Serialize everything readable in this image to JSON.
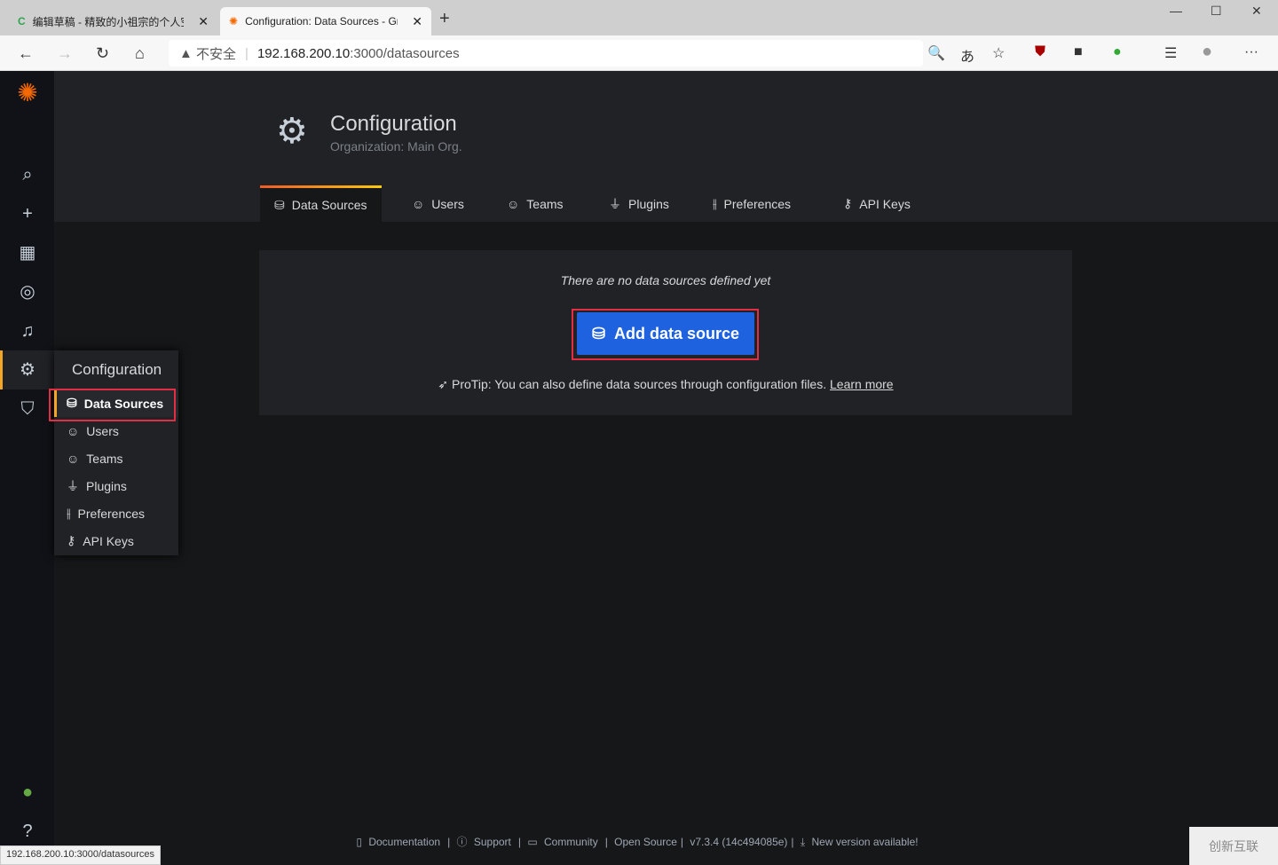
{
  "browser": {
    "tabs": [
      {
        "title": "编辑草稿 - 精致的小祖宗的个人空"
      },
      {
        "title": "Configuration: Data Sources - Gr"
      }
    ],
    "security": "不安全",
    "url_host": "192.168.200.10",
    "url_rest": ":3000/datasources",
    "status_url": "192.168.200.10:3000/datasources"
  },
  "header": {
    "title": "Configuration",
    "subtitle": "Organization: Main Org."
  },
  "tabs": [
    {
      "label": "Data Sources"
    },
    {
      "label": "Users"
    },
    {
      "label": "Teams"
    },
    {
      "label": "Plugins"
    },
    {
      "label": "Preferences"
    },
    {
      "label": "API Keys"
    }
  ],
  "empty": {
    "message": "There are no data sources defined yet",
    "button": "Add data source",
    "protip": "ProTip: You can also define data sources through configuration files.",
    "learn_more": "Learn more"
  },
  "menu": {
    "title": "Configuration",
    "items": [
      {
        "label": "Data Sources"
      },
      {
        "label": "Users"
      },
      {
        "label": "Teams"
      },
      {
        "label": "Plugins"
      },
      {
        "label": "Preferences"
      },
      {
        "label": "API Keys"
      }
    ]
  },
  "footer": {
    "documentation": "Documentation",
    "support": "Support",
    "community": "Community",
    "open_source": "Open Source",
    "version": "v7.3.4 (14c494085e)",
    "new_version": "New version available!"
  },
  "watermark": "创新互联",
  "colors": {
    "accent": "#f5a623",
    "button": "#1f62e0",
    "highlight": "#e02f44"
  }
}
